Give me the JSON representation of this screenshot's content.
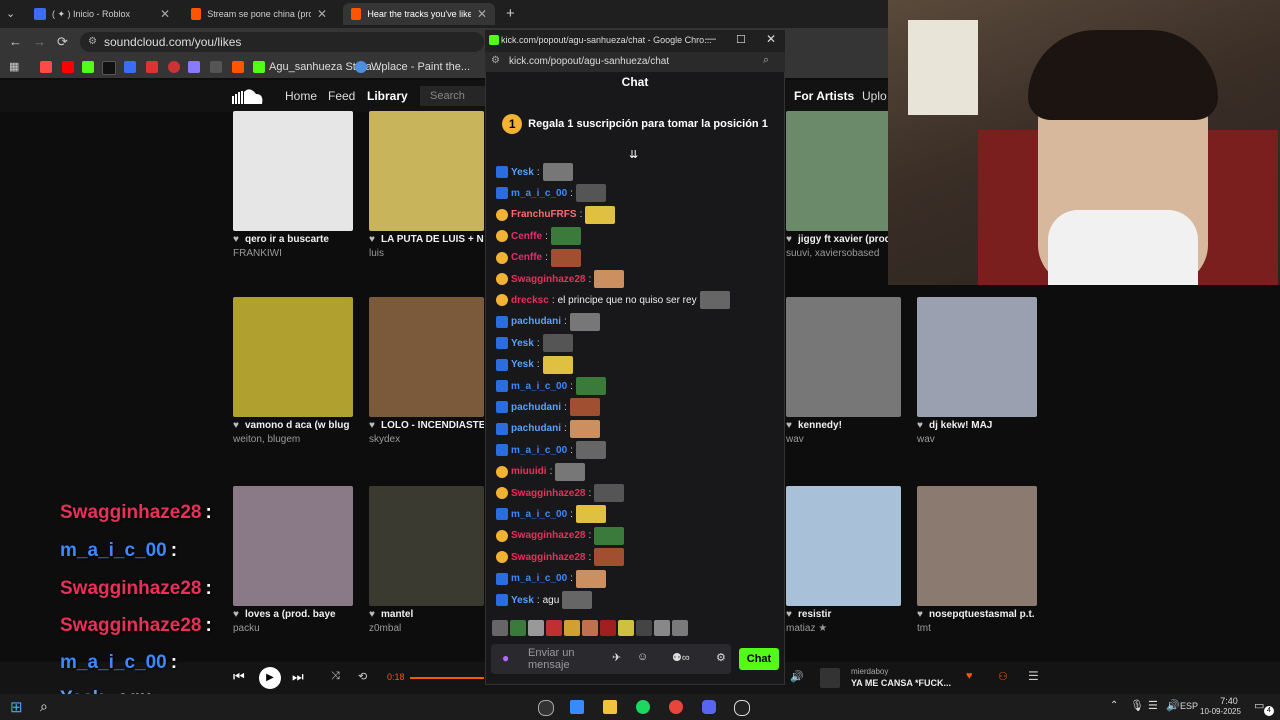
{
  "browser": {
    "tabs": [
      {
        "label": "( ✦ ) Inicio - Roblox",
        "color": "#3b6cf6"
      },
      {
        "label": "Stream se pone china (prod. p",
        "color": "#ff5500"
      },
      {
        "label": "Hear the tracks you've liked: o",
        "color": "#ff5500",
        "active": true
      }
    ],
    "address": "soundcloud.com/you/likes",
    "bookmarks": [
      "Agu_sanhueza Strea...",
      "Wplace - Paint the..."
    ]
  },
  "soundcloud": {
    "nav": {
      "home": "Home",
      "feed": "Feed",
      "library": "Library",
      "search_placeholder": "Search",
      "for_artists": "For Artists",
      "upload": "Uplo"
    },
    "tracks": [
      {
        "title": "qero ir a buscarte",
        "artist": "FRANKIWI",
        "color": "#e6e6e6"
      },
      {
        "title": "LA PUTA DE LUIS + N",
        "artist": "luis",
        "color": "#c8b45a"
      },
      {
        "title": "jiggy ft xavier (prod.",
        "artist": "suuvi, xaviersobased",
        "color": "#6a8a6a"
      },
      {
        "title": "vamono d aca (w blug",
        "artist": "weiton, blugem",
        "color": "#b0a030"
      },
      {
        "title": "LOLO - INCENDIASTE",
        "artist": "skydex",
        "color": "#7a5a3a"
      },
      {
        "title": "kennedy!",
        "artist": "wav",
        "color": "#777777"
      },
      {
        "title": "dj kekw! MAJ",
        "artist": "wav",
        "color": "#9aa0b0"
      },
      {
        "title": "loves a (prod. baye",
        "artist": "packu",
        "color": "#8a7a88"
      },
      {
        "title": "mantel",
        "artist": "z0mbal",
        "color": "#3a3a30"
      },
      {
        "title": "resistir",
        "artist": "matiaz ★",
        "color": "#a8c0d8"
      },
      {
        "title": "nosepqtuestasmal p.t.",
        "artist": "tmt",
        "color": "#8a7a70"
      }
    ],
    "player": {
      "time": "0:18",
      "artist": "mierdaboy",
      "title": "YA ME CANSA *FUCK..."
    }
  },
  "kick": {
    "window_title": "kick.com/popout/agu-sanhueza/chat - Google Chro...",
    "url": "kick.com/popout/agu-sanhueza/chat",
    "header": "Chat",
    "gift_rank": "1",
    "gift_text": "Regala 1 suscripción para tomar la posición 1",
    "messages": [
      {
        "user": "Yesk",
        "color": "#5aa0ff",
        "text": ""
      },
      {
        "user": "m_a_i_c_00",
        "color": "#3a8aff",
        "text": ""
      },
      {
        "user": "FranchuFRFS",
        "color": "#ff6b6b",
        "text": ""
      },
      {
        "user": "Cenffe",
        "color": "#e0306a",
        "text": ""
      },
      {
        "user": "Cenffe",
        "color": "#e0306a",
        "text": ""
      },
      {
        "user": "Swagginhaze28",
        "color": "#e8305a",
        "text": ""
      },
      {
        "user": "drecksc",
        "color": "#e8305a",
        "text": "el principe que no quiso ser rey"
      },
      {
        "user": "pachudani",
        "color": "#5aa0ff",
        "text": ""
      },
      {
        "user": "Yesk",
        "color": "#5aa0ff",
        "text": ""
      },
      {
        "user": "Yesk",
        "color": "#5aa0ff",
        "text": ""
      },
      {
        "user": "m_a_i_c_00",
        "color": "#3a8aff",
        "text": ""
      },
      {
        "user": "pachudani",
        "color": "#5aa0ff",
        "text": ""
      },
      {
        "user": "pachudani",
        "color": "#5aa0ff",
        "text": ""
      },
      {
        "user": "m_a_i_c_00",
        "color": "#3a8aff",
        "text": ""
      },
      {
        "user": "miuuidi",
        "color": "#e8305a",
        "text": ""
      },
      {
        "user": "Swagginhaze28",
        "color": "#e8305a",
        "text": ""
      },
      {
        "user": "m_a_i_c_00",
        "color": "#3a8aff",
        "text": ""
      },
      {
        "user": "Swagginhaze28",
        "color": "#e8305a",
        "text": ""
      },
      {
        "user": "Swagginhaze28",
        "color": "#e8305a",
        "text": ""
      },
      {
        "user": "m_a_i_c_00",
        "color": "#3a8aff",
        "text": ""
      },
      {
        "user": "Yesk",
        "color": "#5aa0ff",
        "text": "agu"
      }
    ],
    "input_placeholder": "Enviar un mensaje",
    "send_label": "Chat"
  },
  "overlay": [
    {
      "user": "Swagginhaze28",
      "color": "#e8305a",
      "text": ""
    },
    {
      "user": "m_a_i_c_00",
      "color": "#3a8aff",
      "text": ""
    },
    {
      "user": "Swagginhaze28",
      "color": "#e8305a",
      "text": ""
    },
    {
      "user": "Swagginhaze28",
      "color": "#e8305a",
      "text": ""
    },
    {
      "user": "m_a_i_c_00",
      "color": "#3a8aff",
      "text": ""
    },
    {
      "user": "Yesk",
      "color": "#5aa0ff",
      "text": "agu"
    }
  ],
  "taskbar": {
    "lang": "ESP",
    "time": "7:40",
    "date": "10-09-2025",
    "notif": "4"
  }
}
